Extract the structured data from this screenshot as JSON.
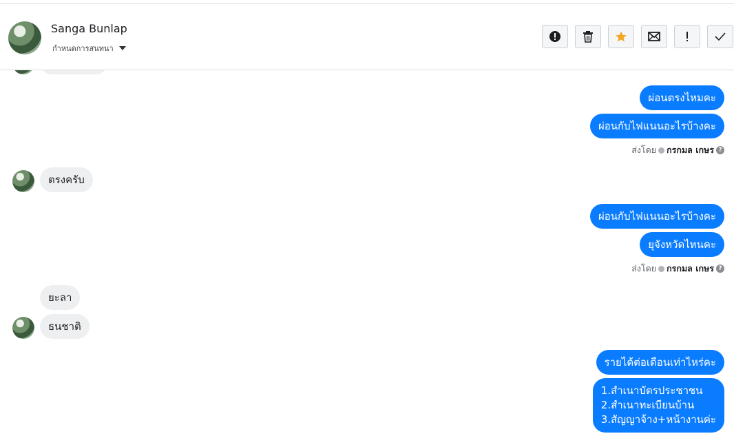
{
  "header": {
    "name": "Sanga Bunlap",
    "assign_label": "กำหนดการสนทนา"
  },
  "toolbar": {
    "icons": [
      "alert-icon",
      "trash-icon",
      "star-icon",
      "mail-icon",
      "exclamation-icon",
      "check-icon"
    ],
    "star_color": "#f5a623"
  },
  "messages": {
    "m1": "ผ่อนตรงไหมคะ",
    "m2": "ผ่อนกับไฟแนนอะไรบ้างคะ",
    "sent1": {
      "prefix": "ส่งโดย",
      "agent": "กรกมล เกษร"
    },
    "m3": "ตรงครับ",
    "m4": "ผ่อนกับไฟแนนอะไรบ้างคะ",
    "m5": "ยุจังหวัดไหนคะ",
    "sent2": {
      "prefix": "ส่งโดย",
      "agent": "กรกมล เกษร"
    },
    "m6": "ยะลา",
    "m7": "ธนชาติ",
    "m8": "รายได้ต่อเดือนเท่าไหร่คะ",
    "m9": [
      "1.สำเนาบัตรประชาชน",
      "2.สำเนาทะเบียนบ้าน",
      "3.สัญญาจ้าง+หน้างานค่ะ"
    ]
  },
  "colors": {
    "outgoing_bubble": "#0a7cff",
    "incoming_bubble": "#eeeff1"
  }
}
